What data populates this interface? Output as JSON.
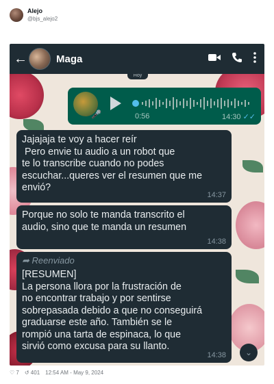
{
  "post": {
    "author_name": "Alejo",
    "author_handle": "@bjs_alejo2",
    "likes": "7",
    "retweets": "401",
    "timestamp": "12:54 AM - May 9, 2024"
  },
  "chat": {
    "contact_name": "Maga",
    "day_chip": "Hoy",
    "audio": {
      "duration": "0:56",
      "time": "14:30"
    },
    "messages": [
      {
        "text": "Jajajaja te voy a hacer reír\n Pero envie tu audio a un robot que\nte lo transcribe cuando no podes\nescuchar...queres ver el resumen que me\nenvió?",
        "time": "14:37"
      },
      {
        "text": "Porque no solo te manda transcrito el\naudio, sino que te manda un resumen",
        "time": "14:38"
      },
      {
        "forwarded_label": "Reenviado",
        "text": "[RESUMEN]\nLa persona llora por la frustración de\nno encontrar trabajo y por sentirse\nsobrepasada debido a que no conseguirá\ngraduarse este año. También se le\nrompió una tarta de espinaca, lo que\nsirvió como excusa para su llanto.",
        "time": "14:38"
      }
    ]
  },
  "icons": {
    "back": "arrow-left-icon",
    "video": "video-call-icon",
    "call": "phone-icon",
    "menu": "more-vertical-icon",
    "play": "play-icon",
    "mic": "mic-icon",
    "forward": "forward-icon",
    "scroll": "chevron-down-icon",
    "like": "heart-icon",
    "retweet": "retweet-icon"
  },
  "colors": {
    "header_bg": "#1f2c34",
    "incoming_bubble": "#1f2c34",
    "outgoing_bubble": "#005c4b",
    "read_ticks": "#53bdeb"
  }
}
